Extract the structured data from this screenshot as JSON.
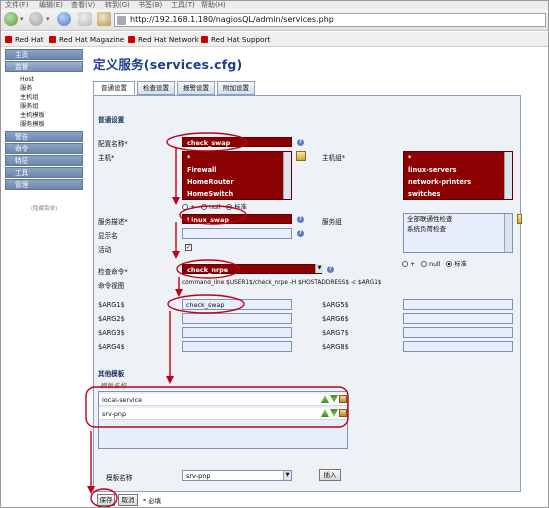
{
  "browser": {
    "menu": [
      "文件(F)",
      "编辑(E)",
      "查看(V)",
      "转到(G)",
      "书签(B)",
      "工具(T)",
      "帮助(H)"
    ],
    "url": "http://192.168.1.180/nagiosQL/admin/services.php",
    "bookmarks": [
      "Red Hat",
      "Red Hat Magazine",
      "Red Hat Network",
      "Red Hat Support"
    ]
  },
  "sidebar": {
    "sections": [
      {
        "label": "主页",
        "active": false
      },
      {
        "label": "监督",
        "active": true,
        "items": [
          "Host",
          "服务",
          "主机组",
          "服务组",
          "主机模板",
          "服务模板"
        ]
      },
      {
        "label": "警告",
        "active": false
      },
      {
        "label": "命令",
        "active": false
      },
      {
        "label": "特征",
        "active": false
      },
      {
        "label": "工具",
        "active": false
      },
      {
        "label": "管理",
        "active": false
      }
    ],
    "footer": "(隐藏菜单)"
  },
  "page": {
    "title": "定义服务(services.cfg)",
    "tabs": [
      "普通设置",
      "检查设置",
      "报警设置",
      "附加设置"
    ]
  },
  "form": {
    "section_general": "普通设置",
    "config_name_label": "配置名称*",
    "config_name_value": "check_swap",
    "host_label": "主机*",
    "host_options": [
      "*",
      "Firewall",
      "HomeRouter",
      "HomeSwitch"
    ],
    "hostgroup_label": "主机组*",
    "hostgroup_options": [
      "*",
      "linux-servers",
      "network-printers",
      "switches"
    ],
    "radio_options": [
      "+",
      "null",
      "标准"
    ],
    "service_desc_label": "服务描述*",
    "service_desc_value": "Linux_swap",
    "servicegroup_label": "服务组",
    "servicegroup_options": [
      "全部联通性检查",
      "系统负荷检查"
    ],
    "display_name_label": "显示名",
    "active_label": "活动",
    "active_checked": "✓",
    "check_command_label": "检查命令*",
    "check_command_value": "check_nrpe",
    "command_view_label": "命令视图",
    "command_view_value": "command_line $USER1$/check_nrpe -H $HOSTADDRESS$ -c $ARG1$",
    "args_left": [
      {
        "label": "$ARG1$",
        "value": "check_swap"
      },
      {
        "label": "$ARG2$",
        "value": ""
      },
      {
        "label": "$ARG3$",
        "value": ""
      },
      {
        "label": "$ARG4$",
        "value": ""
      }
    ],
    "args_right": [
      {
        "label": "$ARG5$",
        "value": ""
      },
      {
        "label": "$ARG6$",
        "value": ""
      },
      {
        "label": "$ARG7$",
        "value": ""
      },
      {
        "label": "$ARG8$",
        "value": ""
      }
    ],
    "section_templates": "其他模板",
    "template_name_header": "模板名称",
    "templates": [
      "local-service",
      "srv-pnp"
    ],
    "template_select_label": "模板名称",
    "template_select_value": "srv-pnp",
    "insert_button": "插入",
    "save_button": "保存",
    "cancel_button": "取消",
    "required_note": "* 必填"
  },
  "colors": {
    "selected_red": "#8b0000",
    "annotation_red": "#c0001a",
    "title_blue": "#1e3d8f",
    "panel_bg": "#eef1f5"
  }
}
